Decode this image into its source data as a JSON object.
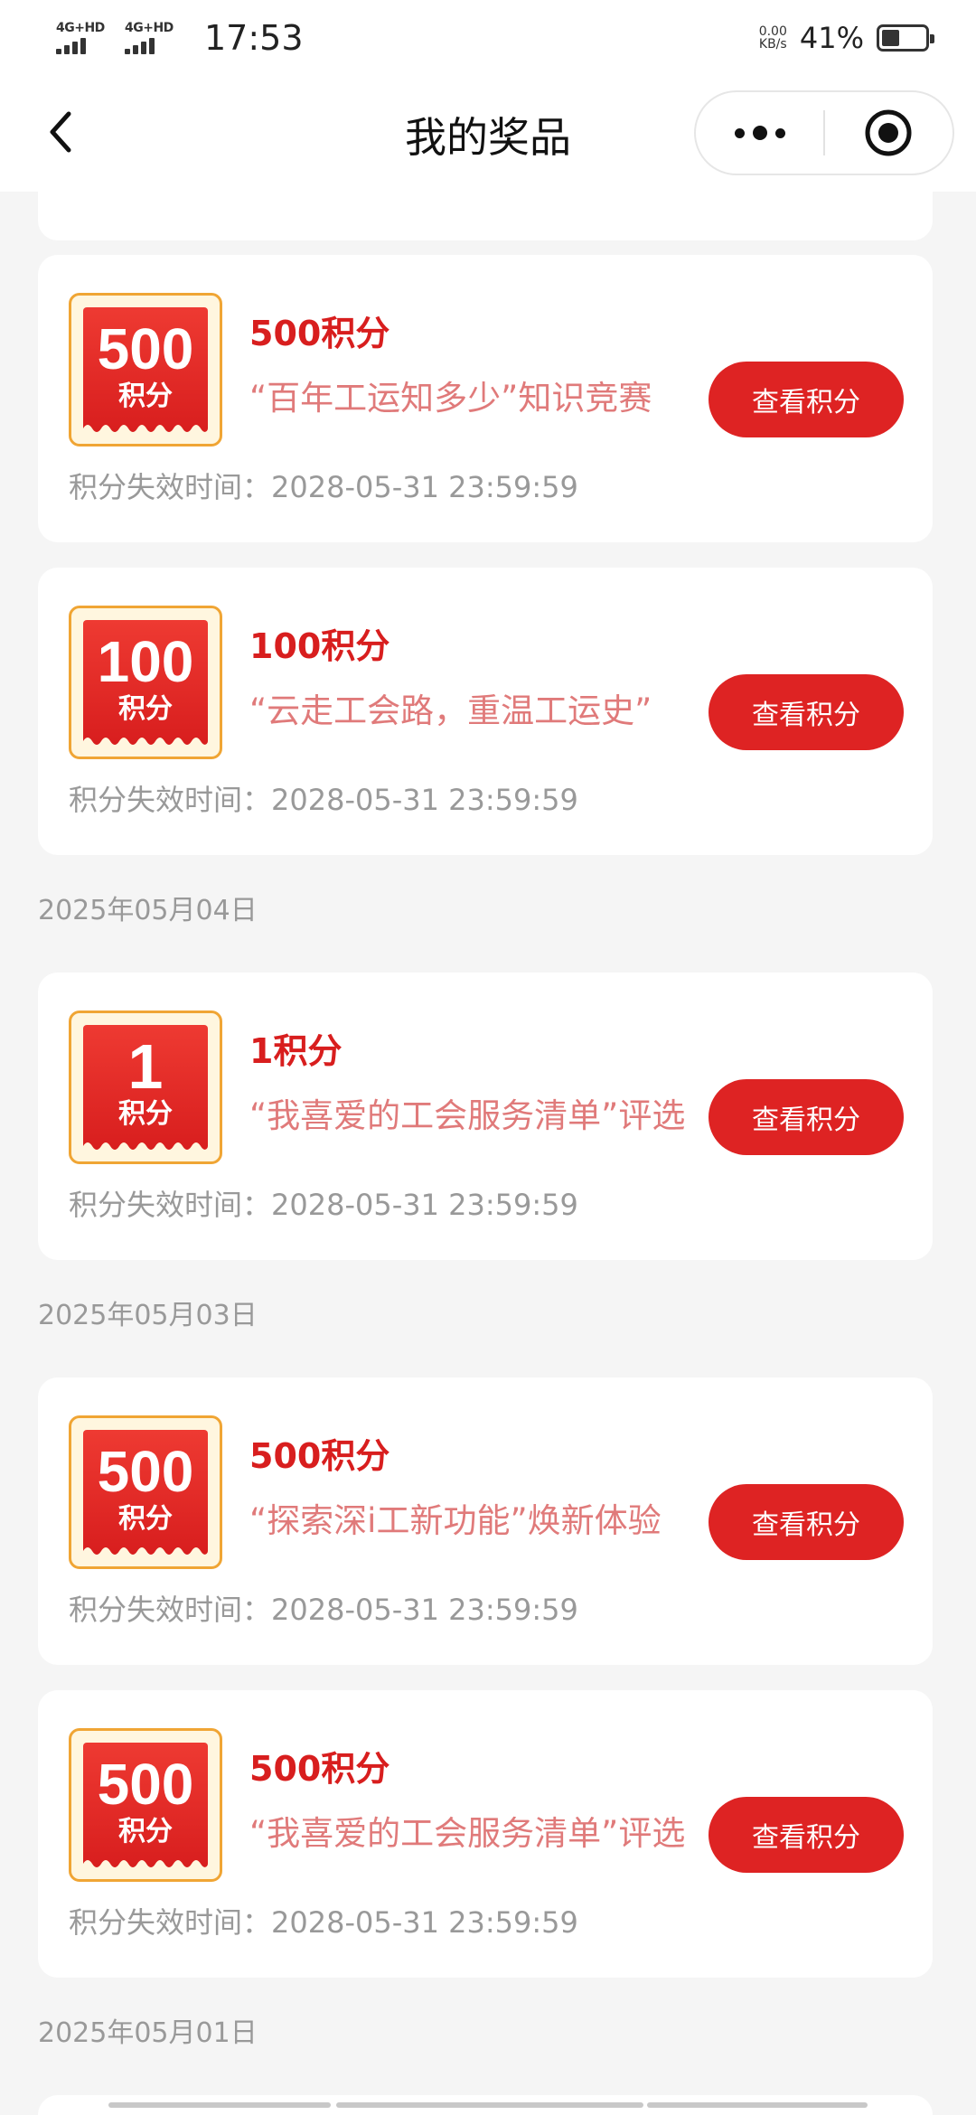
{
  "status_bar": {
    "network1": "4G+HD",
    "network2": "4G+HD",
    "time": "17:53",
    "net_speed_value": "0.00",
    "net_speed_unit": "KB/s",
    "battery_percent": "41%",
    "battery_level": 0.41
  },
  "nav": {
    "title": "我的奖品"
  },
  "groups": [
    {
      "date": "",
      "prizes": [
        {
          "badge_value": "500",
          "badge_unit": "积分",
          "title": "500积分",
          "description": "“百年工运知多少”知识竞赛",
          "button": "查看积分",
          "expiry": "积分失效时间：2028-05-31 23:59:59"
        },
        {
          "badge_value": "100",
          "badge_unit": "积分",
          "title": "100积分",
          "description": "“云走工会路，重温工运史”",
          "button": "查看积分",
          "expiry": "积分失效时间：2028-05-31 23:59:59"
        }
      ]
    },
    {
      "date": "2025年05月04日",
      "prizes": [
        {
          "badge_value": "1",
          "badge_unit": "积分",
          "title": "1积分",
          "description": "“我喜爱的工会服务清单”评选",
          "button": "查看积分",
          "expiry": "积分失效时间：2028-05-31 23:59:59"
        }
      ]
    },
    {
      "date": "2025年05月03日",
      "prizes": [
        {
          "badge_value": "500",
          "badge_unit": "积分",
          "title": "500积分",
          "description": "“探索深i工新功能”焕新体验",
          "button": "查看积分",
          "expiry": "积分失效时间：2028-05-31 23:59:59"
        },
        {
          "badge_value": "500",
          "badge_unit": "积分",
          "title": "500积分",
          "description": "“我喜爱的工会服务清单”评选",
          "button": "查看积分",
          "expiry": "积分失效时间：2028-05-31 23:59:59"
        }
      ]
    },
    {
      "date": "2025年05月01日",
      "prizes": []
    }
  ],
  "colors": {
    "accent": "#de2323",
    "title_red": "#d81e1e",
    "desc_pink": "#e07a7a",
    "badge_border": "#f0a534",
    "muted_text": "#999999",
    "background": "#f5f5f5"
  }
}
